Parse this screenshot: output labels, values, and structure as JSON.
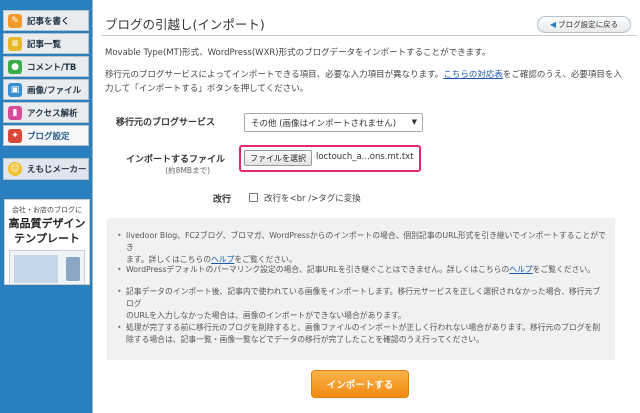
{
  "sidebar": {
    "items": [
      {
        "label": "記事を書く",
        "icon": "pencil-icon",
        "color": "#f29a2e"
      },
      {
        "label": "記事一覧",
        "icon": "list-icon",
        "color": "#e7b928"
      },
      {
        "label": "コメント/TB",
        "icon": "comment-icon",
        "color": "#3aab4a"
      },
      {
        "label": "画像/ファイル",
        "icon": "image-icon",
        "color": "#3a8fd0"
      },
      {
        "label": "アクセス解析",
        "icon": "chart-icon",
        "color": "#d64c9a"
      },
      {
        "label": "ブログ設定",
        "icon": "wrench-icon",
        "color": "#d94a3a"
      }
    ],
    "emoji_item": {
      "label": "えもじメーカー",
      "icon": "emoji-face-icon",
      "color": "#f2c12e"
    },
    "promo": {
      "line1": "会社・お店のブログに",
      "line2": "高品質デザイン",
      "line3": "テンプレート"
    }
  },
  "page": {
    "title": "ブログの引越し(インポート)",
    "back_button": "ブログ設定に戻る",
    "desc1": "Movable Type(MT)形式、WordPress(WXR)形式のブログデータをインポートすることができます。",
    "desc2_pre": "移行元のブログサービスによってインポートできる項目、必要な入力項目が異なります。",
    "desc2_link": "こちらの対応表",
    "desc2_post": "をご確認のうえ、必要項目を入",
    "desc3": "力して「インポートする」ボタンを押してください。"
  },
  "form": {
    "source_label": "移行元のブログサービス",
    "source_value": "その他 (画像はインポートされません)",
    "file_label": "インポートするファイル",
    "file_sublabel": "(約8MBまで)",
    "file_button": "ファイルを選択",
    "file_name": "loctouch_a...ons.mt.txt",
    "newline_label": "改行",
    "newline_checkbox_label": "改行を<br />タグに変換",
    "newline_checked": false
  },
  "notes": [
    {
      "pre": "livedoor Blog、FC2ブログ、ブロマガ、WordPressからのインポートの場合、個別記事のURL形式を引き継いでインポートすることができ",
      "line2_pre": "ます。詳しくはこちらの",
      "link": "ヘルプ",
      "post": "をご覧ください。"
    },
    {
      "pre": "WordPressデフォルトのパーマリンク設定の場合、記事URLを引き継ぐことはできません。詳しくはこちらの",
      "link": "ヘルプ",
      "post": "をご覧ください。"
    },
    {
      "text1": "記事データのインポート後、記事内で使われている画像をインポートします。移行元サービスを正しく選択されなかった場合、移行元ブログ",
      "text2": "のURLを入力しなかった場合は、画像のインポートができない場合があります。"
    },
    {
      "text1": "処理が完了する前に移行元のブログを削除すると、画像ファイルのインポートが正しく行われない場合があります。移行元のブログを削",
      "text2": "除する場合は、記事一覧・画像一覧などでデータの移行が完了したことを確認のうえ行ってください。"
    }
  ],
  "import_button": "インポートする",
  "colors": {
    "sidebar_bg": "#2a7fbf",
    "highlight_border": "#e2266f",
    "import_button": "#f39b1f",
    "link": "#1a58b0"
  }
}
